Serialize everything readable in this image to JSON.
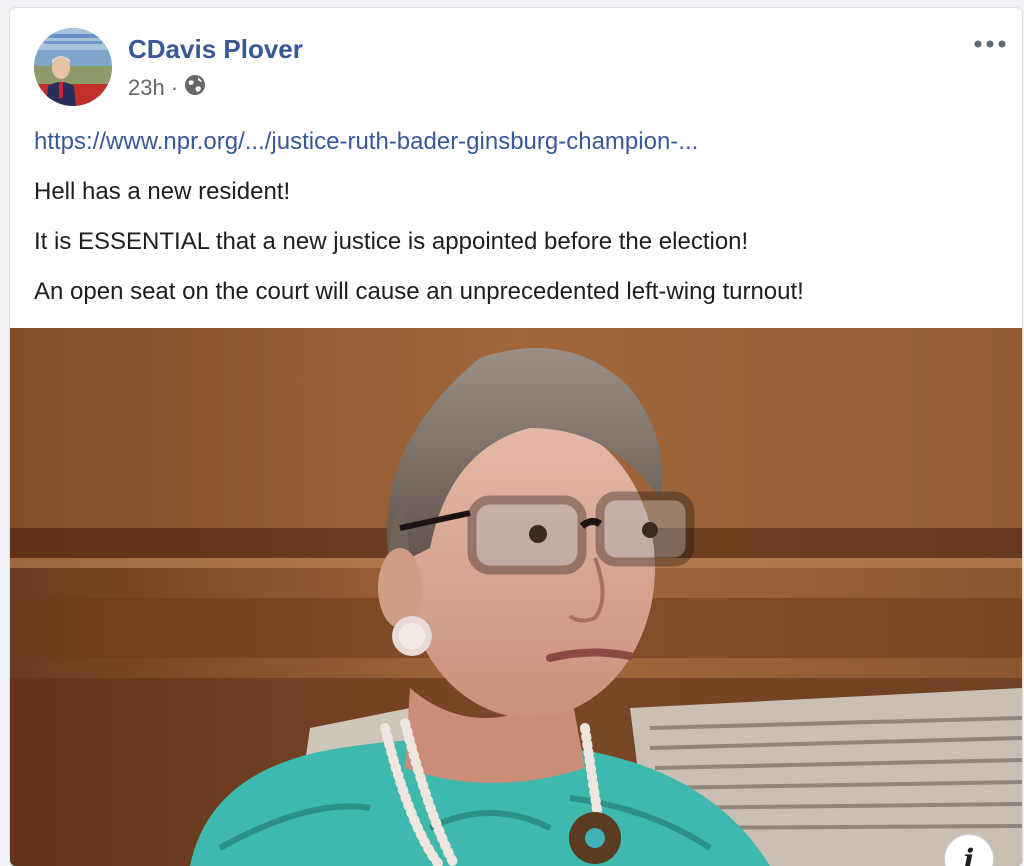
{
  "post": {
    "author": "CDavis Plover",
    "time": "23h",
    "separator": "·",
    "privacy_icon": "globe-icon",
    "more_icon": "more-options-icon",
    "link_text": "https://www.npr.org/.../justice-ruth-bader-ginsburg-champion-...",
    "lines": [
      "Hell has a new resident!",
      "It is ESSENTIAL that a new justice is appointed before the election!",
      "An open seat on the court will cause an unprecedented left-wing turnout!"
    ],
    "info_label": "i"
  },
  "colors": {
    "link": "#385898",
    "text": "#1c1e21",
    "muted": "#65676b",
    "card_bg": "#ffffff",
    "page_bg": "#f0f2f5"
  }
}
